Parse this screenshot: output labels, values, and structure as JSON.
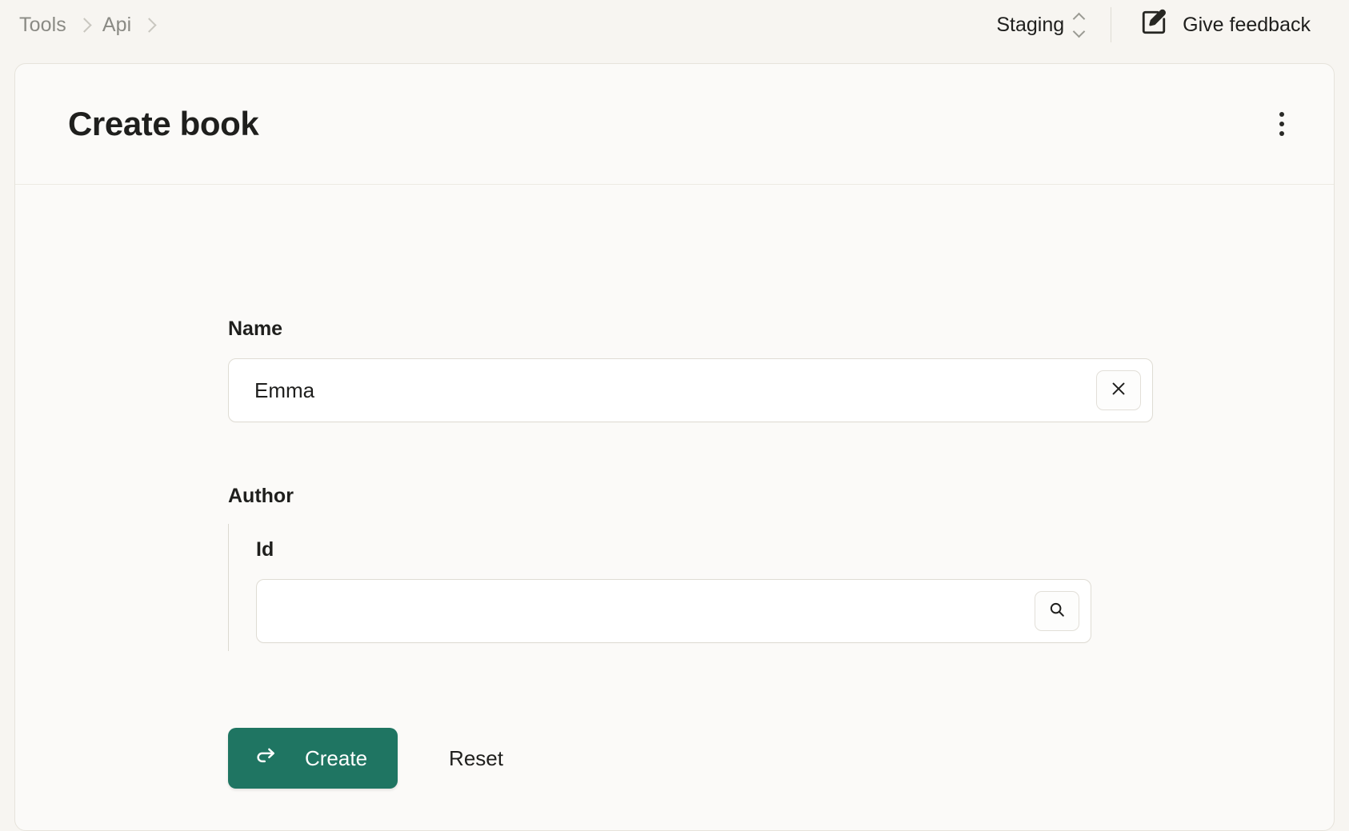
{
  "topbar": {
    "breadcrumb": [
      {
        "label": "Tools"
      },
      {
        "label": "Api"
      }
    ],
    "environment": {
      "value": "Staging",
      "icon": "chevron-updown-icon"
    },
    "feedback": {
      "label": "Give feedback",
      "icon": "edit-square-icon"
    }
  },
  "card": {
    "title": "Create book",
    "menu_icon": "kebab-menu-icon"
  },
  "form": {
    "name": {
      "label": "Name",
      "value": "Emma",
      "placeholder": "",
      "clear_icon": "close-icon"
    },
    "author": {
      "label": "Author",
      "id": {
        "label": "Id",
        "value": "",
        "placeholder": "",
        "search_icon": "search-icon"
      }
    },
    "actions": {
      "create_label": "Create",
      "create_icon": "redo-arrow-icon",
      "reset_label": "Reset"
    }
  },
  "colors": {
    "page_bg": "#f7f5f1",
    "card_bg": "#fbfaf8",
    "accent_green": "#1f7562",
    "text": "#1f1f1d",
    "muted_text": "#8a8a84",
    "border": "#dfdcd4"
  }
}
